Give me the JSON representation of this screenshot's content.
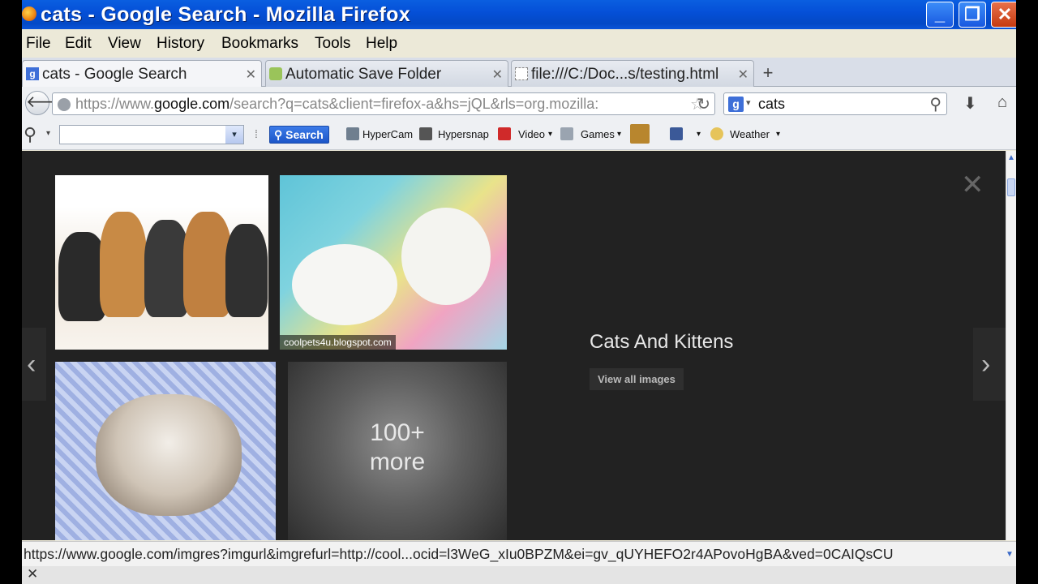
{
  "window": {
    "title": "cats - Google Search - Mozilla Firefox"
  },
  "menu": [
    "File",
    "Edit",
    "View",
    "History",
    "Bookmarks",
    "Tools",
    "Help"
  ],
  "tabs": [
    {
      "label": "cats - Google Search"
    },
    {
      "label": "Automatic Save Folder"
    },
    {
      "label": "file:///C:/Doc...s/testing.html"
    }
  ],
  "newtab_label": "+",
  "navbar": {
    "url_prefix": "https://www.",
    "url_host": "google.com",
    "url_rest": "/search?q=cats&client=firefox-a&hs=jQL&rls=org.mozilla:",
    "search_query": "cats"
  },
  "toolbar": {
    "search_button": "Search",
    "items": [
      "HyperCam",
      "Hypersnap",
      "Video",
      "Games",
      "Weather"
    ]
  },
  "content": {
    "image_caption": "coolpets4u.blogspot.com",
    "more_line1": "100+",
    "more_line2": "more",
    "heading": "Cats And Kittens",
    "view_all": "View all images"
  },
  "status": {
    "url": "https://www.google.com/imgres?imgurl&imgrefurl=http://cool...ocid=l3WeG_xIu0BPZM&ei=gv_qUYHEFO2r4APovoHgBA&ved=0CAIQsCU"
  },
  "colors": {
    "titlebar": "#0550d8",
    "content_bg": "#222222",
    "search_button": "#1c56c8"
  }
}
